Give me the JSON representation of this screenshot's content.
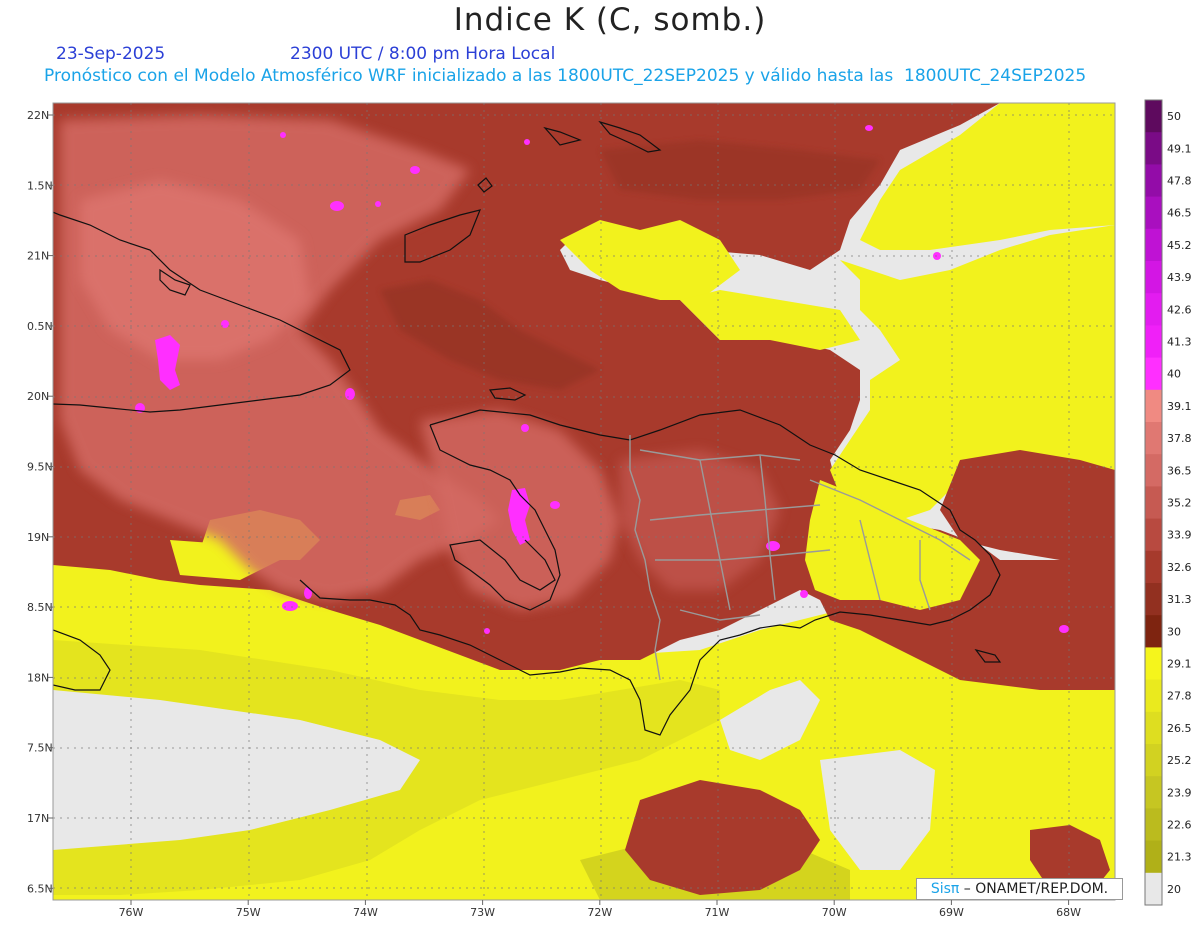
{
  "header": {
    "title": "Indice K (C, somb.)",
    "date": "23-Sep-2025",
    "time": "2300 UTC / 8:00 pm Hora Local",
    "description": "Pronóstico con el Modelo Atmosférico WRF inicializado a las 1800UTC_22SEP2025 y válido hasta las  1800UTC_24SEP2025"
  },
  "axes": {
    "lat_labels": [
      "22N",
      "1.5N",
      "21N",
      "0.5N",
      "20N",
      "9.5N",
      "19N",
      "8.5N",
      "18N",
      "7.5N",
      "17N",
      "6.5N"
    ],
    "lon_labels": [
      "76W",
      "75W",
      "74W",
      "73W",
      "72W",
      "71W",
      "70W",
      "69W",
      "68W"
    ]
  },
  "colorbar": {
    "levels": [
      "50",
      "49.1",
      "47.8",
      "46.5",
      "45.2",
      "43.9",
      "42.6",
      "41.3",
      "40",
      "39.1",
      "37.8",
      "36.5",
      "35.2",
      "33.9",
      "32.6",
      "31.3",
      "30",
      "29.1",
      "27.8",
      "26.5",
      "25.2",
      "23.9",
      "22.6",
      "21.3",
      "20"
    ],
    "colors": [
      "#5e0a5e",
      "#7a0b86",
      "#930ca8",
      "#a90fbf",
      "#bf12d4",
      "#d316e4",
      "#e31cf0",
      "#f020f8",
      "#ff2fff",
      "#f08a82",
      "#e07872",
      "#d46a64",
      "#c65a52",
      "#b84a40",
      "#a63a2c",
      "#923020",
      "#7e2410",
      "#f5f51c",
      "#eaea1e",
      "#dede20",
      "#d2d221",
      "#c6c622",
      "#bbbb1e",
      "#b0b018",
      "#e8e8e8"
    ]
  },
  "credit": {
    "logo": "Sisπ",
    "text": " – ONAMET/REP.DOM."
  }
}
